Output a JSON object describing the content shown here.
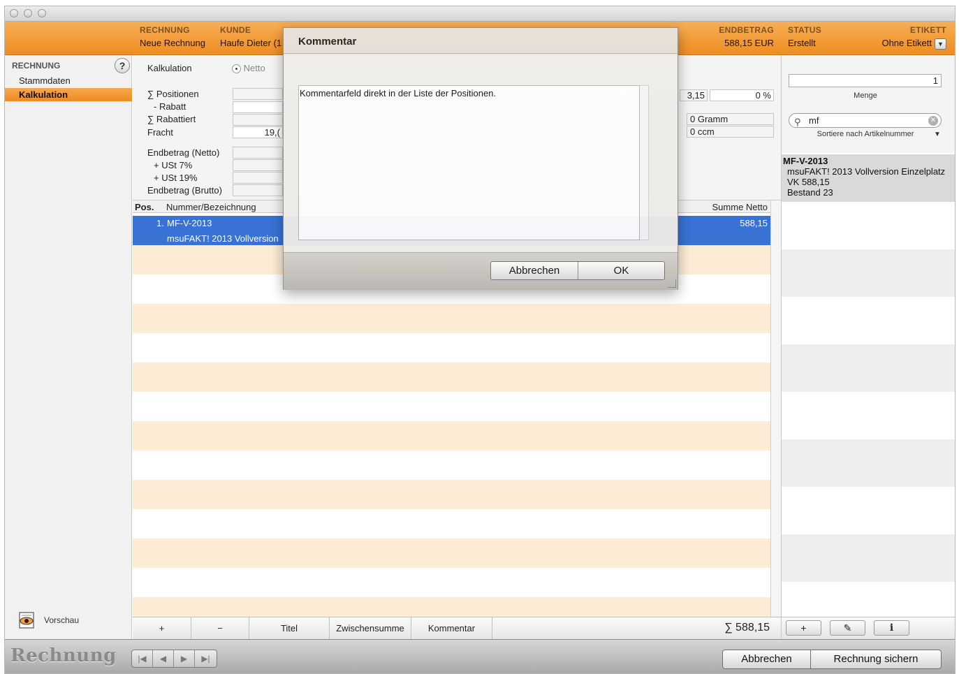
{
  "header": {
    "rechnung_label": "RECHNUNG",
    "rechnung_value": "Neue Rechnung",
    "kunde_label": "KUNDE",
    "kunde_value": "Haufe Dieter (1",
    "endbetrag_label": "ENDBETRAG",
    "endbetrag_value": "588,15 EUR",
    "status_label": "STATUS",
    "status_value": "Erstellt",
    "etikett_label": "ETIKETT",
    "etikett_value": "Ohne Etikett"
  },
  "sidebar": {
    "section": "RECHNUNG",
    "help": "?",
    "items": [
      {
        "label": "Stammdaten"
      },
      {
        "label": "Kalkulation"
      }
    ],
    "preview_label": "Vorschau"
  },
  "calc": {
    "tab_label": "Kalkulation",
    "netto_label": "Netto",
    "positionen_label": "∑ Positionen",
    "rabatt_label": "- Rabatt",
    "rabattiert_label": "∑ Rabattiert",
    "fracht_label": "Fracht",
    "fracht_value": "19,(",
    "endbetrag_netto_label": "Endbetrag (Netto)",
    "ust7_label": "+ USt 7%",
    "ust19_label": "+ USt 19%",
    "endbetrag_brutto_label": "Endbetrag (Brutto)",
    "marge_value": "3,15",
    "marge_pct": "0 %",
    "gewicht_value": "0 Gramm",
    "volumen_value": "0 ccm"
  },
  "list": {
    "col_pos": "Pos.",
    "col_nummer": "Nummer/Bezeichnung",
    "col_summe": "Summe Netto",
    "rows": [
      {
        "pos": "1.",
        "nummer": "MF-V-2013",
        "bezeichnung": "msuFAKT! 2013 Vollversion",
        "summe": "588,15"
      }
    ]
  },
  "list_toolbar": {
    "add": "+",
    "remove": "−",
    "titel": "Titel",
    "zwischensumme": "Zwischensumme",
    "kommentar": "Kommentar",
    "total": "∑ 588,15"
  },
  "right_panel": {
    "menge_value": "1",
    "menge_label": "Menge",
    "search_value": "mf",
    "sort_label": "Sortiere nach Artikelnummer",
    "article": {
      "nummer": "MF-V-2013",
      "name": "msuFAKT! 2013 Vollversion Einzelplatz",
      "vk": "VK 588,15",
      "bestand": "Bestand 23"
    },
    "btn_add": "+",
    "btn_edit": "✎",
    "btn_info": "i"
  },
  "statusbar": {
    "app_label": "Rechnung",
    "nav_first": "|◀",
    "nav_prev": "◀",
    "nav_next": "▶",
    "nav_last": "▶|",
    "cancel": "Abbrechen",
    "save": "Rechnung sichern"
  },
  "dialog": {
    "title": "Kommentar",
    "text": "Kommentarfeld direkt in der Liste der Positionen.",
    "cancel": "Abbrechen",
    "ok": "OK"
  }
}
